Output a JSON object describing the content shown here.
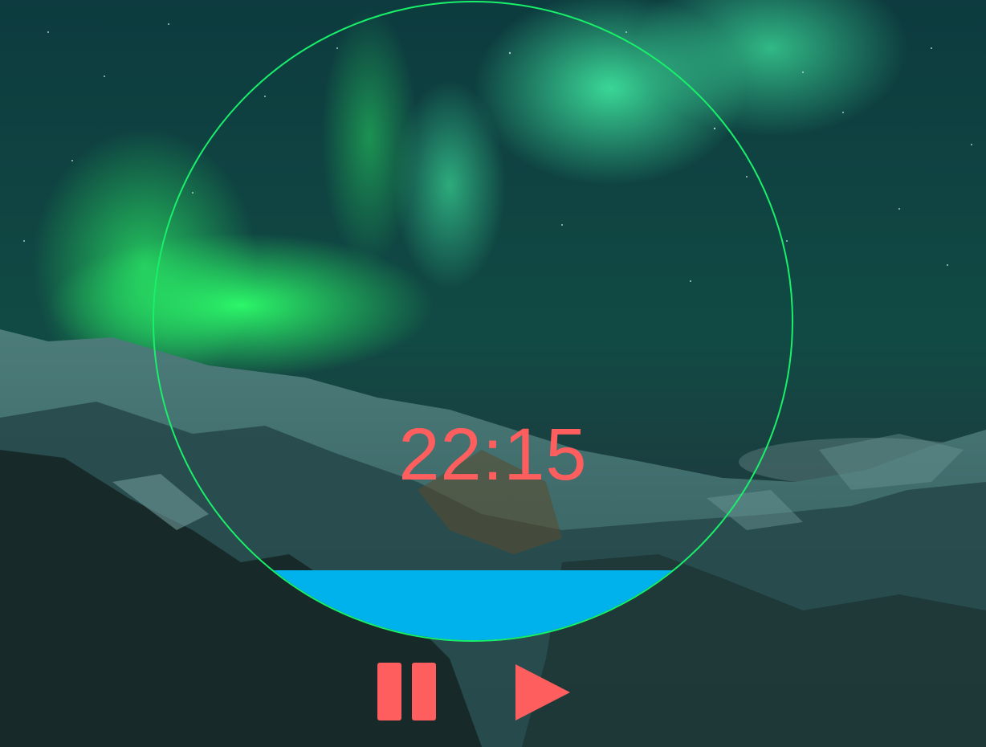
{
  "timer": {
    "time_text": "22:15",
    "progress_fraction": 0.11
  },
  "controls": {
    "pause_icon": "pause-icon",
    "play_icon": "play-icon"
  },
  "colors": {
    "ring": "#18f06a",
    "progress": "#00b2eb",
    "time_text": "#ff5e5e",
    "controls": "#ff5e5e"
  }
}
